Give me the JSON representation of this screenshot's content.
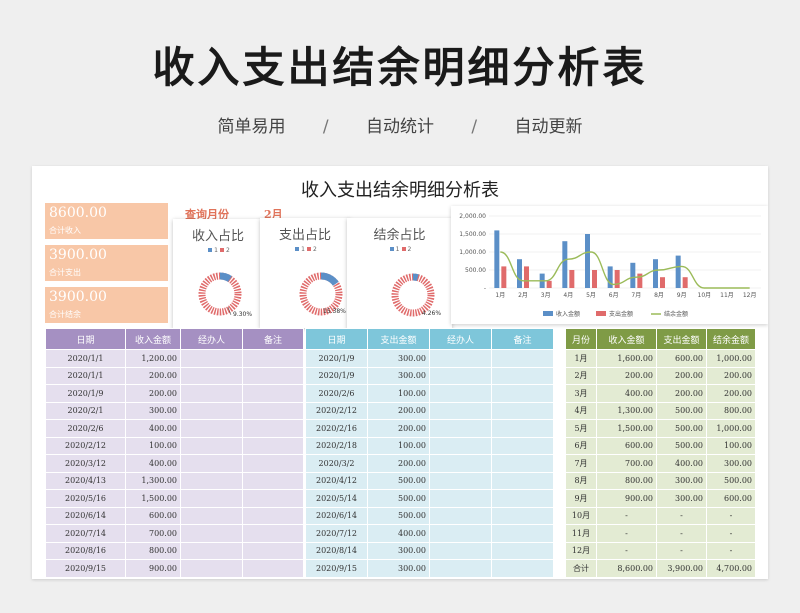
{
  "header": {
    "title": "收入支出结余明细分析表",
    "tags": [
      "简单易用",
      "自动统计",
      "自动更新"
    ],
    "separator": "/"
  },
  "sheet": {
    "title": "收入支出结余明细分析表",
    "kpis": [
      {
        "value": "8600.00",
        "label": "合计收入"
      },
      {
        "value": "3900.00",
        "label": "合计支出"
      },
      {
        "value": "3900.00",
        "label": "合计结余"
      }
    ],
    "query": {
      "label": "查询月份",
      "value": "2月"
    },
    "donuts": [
      {
        "title": "收入占比",
        "legend": [
          "1",
          "2"
        ],
        "percent": "9.30%",
        "share": 0.093
      },
      {
        "title": "支出占比",
        "legend": [
          "1",
          "2"
        ],
        "percent": "15.38%",
        "share": 0.1538
      },
      {
        "title": "结余占比",
        "legend": [
          "1",
          "2"
        ],
        "percent": "4.26%",
        "share": 0.0426
      }
    ],
    "income_table": {
      "headers": [
        "日期",
        "收入金额",
        "经办人",
        "备注"
      ],
      "rows": [
        [
          "2020/1/1",
          "1,200.00"
        ],
        [
          "2020/1/1",
          "200.00"
        ],
        [
          "2020/1/9",
          "200.00"
        ],
        [
          "2020/2/1",
          "300.00"
        ],
        [
          "2020/2/6",
          "400.00"
        ],
        [
          "2020/2/12",
          "100.00"
        ],
        [
          "2020/3/12",
          "400.00"
        ],
        [
          "2020/4/13",
          "1,300.00"
        ],
        [
          "2020/5/16",
          "1,500.00"
        ],
        [
          "2020/6/14",
          "600.00"
        ],
        [
          "2020/7/14",
          "700.00"
        ],
        [
          "2020/8/16",
          "800.00"
        ],
        [
          "2020/9/15",
          "900.00"
        ]
      ]
    },
    "expense_table": {
      "headers": [
        "日期",
        "支出金额",
        "经办人",
        "备注"
      ],
      "rows": [
        [
          "2020/1/9",
          "300.00"
        ],
        [
          "2020/1/9",
          "300.00"
        ],
        [
          "2020/2/6",
          "100.00"
        ],
        [
          "2020/2/12",
          "200.00"
        ],
        [
          "2020/2/16",
          "200.00"
        ],
        [
          "2020/2/18",
          "100.00"
        ],
        [
          "2020/3/2",
          "200.00"
        ],
        [
          "2020/4/12",
          "500.00"
        ],
        [
          "2020/5/14",
          "500.00"
        ],
        [
          "2020/6/14",
          "500.00"
        ],
        [
          "2020/7/12",
          "400.00"
        ],
        [
          "2020/8/14",
          "300.00"
        ],
        [
          "2020/9/15",
          "300.00"
        ]
      ]
    },
    "summary_table": {
      "headers": [
        "月份",
        "收入金额",
        "支出金额",
        "结余金额"
      ],
      "rows": [
        [
          "1月",
          "1,600.00",
          "600.00",
          "1,000.00"
        ],
        [
          "2月",
          "200.00",
          "200.00",
          "200.00"
        ],
        [
          "3月",
          "400.00",
          "200.00",
          "200.00"
        ],
        [
          "4月",
          "1,300.00",
          "500.00",
          "800.00"
        ],
        [
          "5月",
          "1,500.00",
          "500.00",
          "1,000.00"
        ],
        [
          "6月",
          "600.00",
          "500.00",
          "100.00"
        ],
        [
          "7月",
          "700.00",
          "400.00",
          "300.00"
        ],
        [
          "8月",
          "800.00",
          "300.00",
          "500.00"
        ],
        [
          "9月",
          "900.00",
          "300.00",
          "600.00"
        ],
        [
          "10月",
          "-",
          "-",
          "-"
        ],
        [
          "11月",
          "-",
          "-",
          "-"
        ],
        [
          "12月",
          "-",
          "-",
          "-"
        ],
        [
          "合计",
          "8,600.00",
          "3,900.00",
          "4,700.00"
        ]
      ]
    }
  },
  "chart_data": {
    "type": "bar",
    "categories": [
      "1月",
      "2月",
      "3月",
      "4月",
      "5月",
      "6月",
      "7月",
      "8月",
      "9月",
      "10月",
      "11月",
      "12月"
    ],
    "series": [
      {
        "name": "收入金额",
        "type": "bar",
        "color": "#5b8fc7",
        "values": [
          1600,
          800,
          400,
          1300,
          1500,
          600,
          700,
          800,
          900,
          0,
          0,
          0
        ]
      },
      {
        "name": "支出金额",
        "type": "bar",
        "color": "#e06b6b",
        "values": [
          600,
          600,
          200,
          500,
          500,
          500,
          400,
          300,
          300,
          0,
          0,
          0
        ]
      },
      {
        "name": "结余金额",
        "type": "line",
        "color": "#9bbb59",
        "values": [
          1000,
          200,
          200,
          800,
          1000,
          100,
          300,
          500,
          600,
          0,
          0,
          0
        ]
      }
    ],
    "yticks": [
      "2,000.00",
      "1,500.00",
      "1,000.00",
      "500.00",
      "-"
    ],
    "ylim": [
      0,
      2000
    ],
    "legend": "bottom",
    "grid": true
  },
  "colors": {
    "income_header": "#a590c2",
    "expense_header": "#7ec6da",
    "summary_header": "#7f9b46",
    "kpi": "#f8c7a7",
    "query": "#e0735a"
  }
}
